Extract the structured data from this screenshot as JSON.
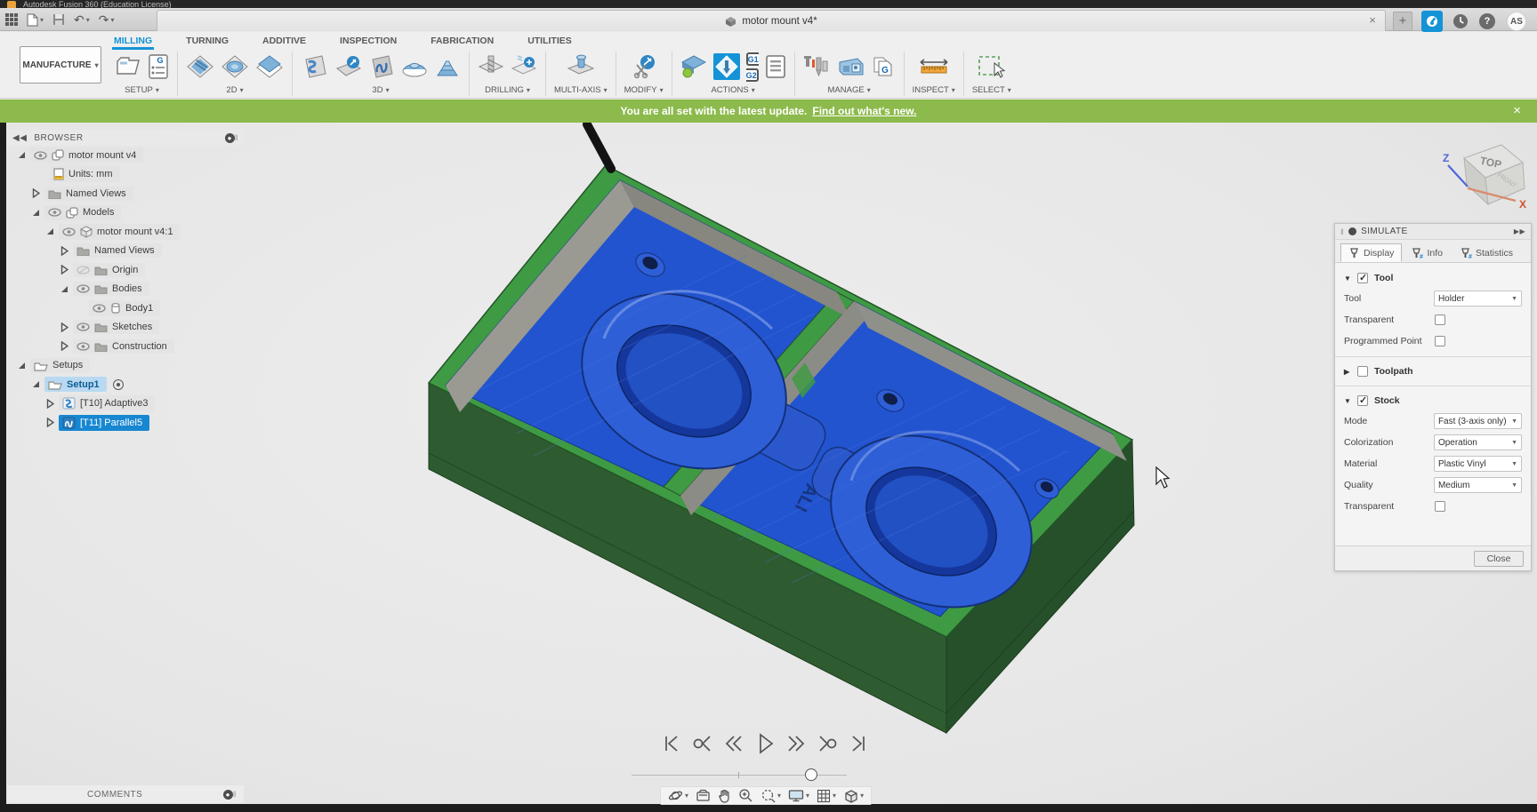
{
  "titlebar": {
    "app_title": "Autodesk Fusion 360 (Education License)"
  },
  "appbar": {
    "document_tab": {
      "title": "motor mount v4*",
      "close": "×"
    },
    "new_tab": "+",
    "help": "?",
    "avatar": "AS"
  },
  "workspace_switcher": {
    "label": "MANUFACTURE"
  },
  "ribbon": {
    "tabs": [
      {
        "label": "MILLING",
        "active": true
      },
      {
        "label": "TURNING"
      },
      {
        "label": "ADDITIVE"
      },
      {
        "label": "INSPECTION"
      },
      {
        "label": "FABRICATION"
      },
      {
        "label": "UTILITIES"
      }
    ],
    "groups": [
      {
        "label": "SETUP"
      },
      {
        "label": "2D"
      },
      {
        "label": "3D"
      },
      {
        "label": "DRILLING"
      },
      {
        "label": "MULTI-AXIS"
      },
      {
        "label": "MODIFY"
      },
      {
        "label": "ACTIONS"
      },
      {
        "label": "MANAGE"
      },
      {
        "label": "INSPECT"
      },
      {
        "label": "SELECT"
      }
    ],
    "glyphs": {
      "g": "G",
      "g1": "G1",
      "g2": "G2"
    }
  },
  "banner": {
    "message": "You are all set with the latest update.",
    "link": "Find out what's new.",
    "close": "×"
  },
  "browser": {
    "title": "BROWSER",
    "rows": [
      {
        "label": "motor mount v4"
      },
      {
        "label": "Units: mm"
      },
      {
        "label": "Named Views"
      },
      {
        "label": "Models"
      },
      {
        "label": "motor mount v4:1"
      },
      {
        "label": "Named Views"
      },
      {
        "label": "Origin"
      },
      {
        "label": "Bodies"
      },
      {
        "label": "Body1"
      },
      {
        "label": "Sketches"
      },
      {
        "label": "Construction"
      },
      {
        "label": "Setups"
      },
      {
        "label": "Setup1",
        "active_setup": true
      },
      {
        "label": "[T10] Adaptive3"
      },
      {
        "label": "[T11] Parallel5",
        "selected": true
      }
    ]
  },
  "simulate": {
    "title": "SIMULATE",
    "tabs": [
      {
        "label": "Display",
        "active": true
      },
      {
        "label": "Info"
      },
      {
        "label": "Statistics"
      }
    ],
    "tool_section": {
      "label": "Tool",
      "checked": true,
      "tool_label": "Tool",
      "tool_value": "Holder",
      "transparent_label": "Transparent",
      "transparent_checked": false,
      "programmed_point_label": "Programmed Point",
      "programmed_point_checked": false
    },
    "toolpath_section": {
      "label": "Toolpath",
      "checked": false
    },
    "stock_section": {
      "label": "Stock",
      "checked": true,
      "mode_label": "Mode",
      "mode_value": "Fast (3-axis only)",
      "colorization_label": "Colorization",
      "colorization_value": "Operation",
      "material_label": "Material",
      "material_value": "Plastic Vinyl",
      "quality_label": "Quality",
      "quality_value": "Medium",
      "transparent_label": "Transparent",
      "transparent_checked": false
    },
    "close_label": "Close"
  },
  "viewcube": {
    "top": "TOP",
    "front": "FRONT",
    "axis_x": "X",
    "axis_z": "Z"
  },
  "canvas": {
    "engraving": "ALI",
    "stock_color": "#3f9a44",
    "machined_color": "#2356d8",
    "wall_color": "#8f8f89",
    "accent_color": "#1493d6",
    "banner_color": "#8dba4c"
  },
  "playback": {
    "icons": [
      "skip-to-start",
      "previous-operation",
      "step-back",
      "play",
      "step-forward",
      "next-operation",
      "skip-to-end"
    ]
  },
  "comments": {
    "title": "COMMENTS"
  }
}
